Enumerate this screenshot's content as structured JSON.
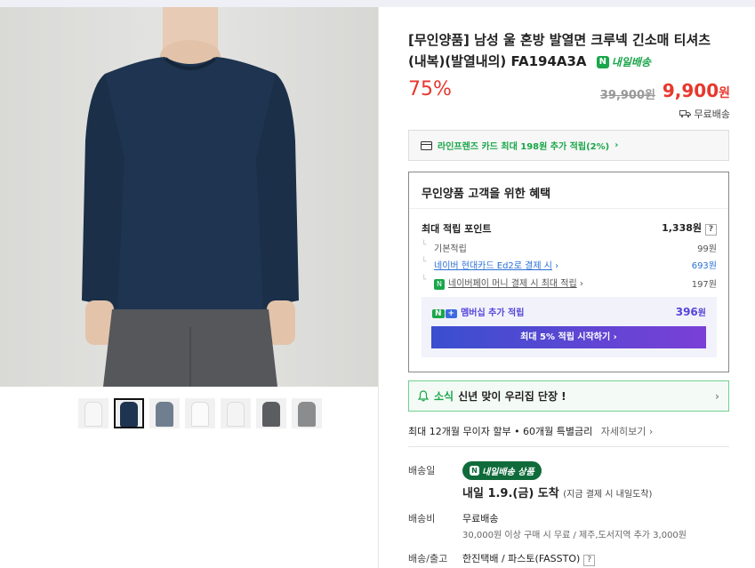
{
  "product": {
    "title": "[무인양품] 남성 울 혼방 발열면 크루넥 긴소매 티셔츠 (내복)(발열내의) FA194A3A",
    "delivery_tag": "내일배송",
    "discount": "75%",
    "original_price": "39,900원",
    "price": "9,900",
    "price_unit": "원",
    "shipping": "무료배송"
  },
  "card_promo": "라인프렌즈 카드 최대 198원 추가 적립(2%)",
  "benefits": {
    "heading": "무인양품 고객을 위한 혜택",
    "max_points_label": "최대 적립 포인트",
    "max_points_value": "1,338원",
    "rows": [
      {
        "label": "기본적립",
        "value": "99원"
      },
      {
        "label": "네이버 현대카드 Ed2로 결제 시",
        "value": "693원"
      },
      {
        "label": "네이버페이 머니 결제 시 최대 적립",
        "value": "197원"
      }
    ],
    "member_label": "멤버십 추가 적립",
    "member_value": "396",
    "member_unit": "원",
    "start_button": "최대 5% 적립 시작하기"
  },
  "news": {
    "tag": "소식",
    "text": "신년 맞이 우리집 단장 !"
  },
  "installment": {
    "text": "최대 12개월 무이자 할부 • 60개월 특별금리",
    "more": "자세히보기"
  },
  "delivery": {
    "label": "배송일",
    "badge": "내일배송 상품",
    "date": "내일 1.9.(금) 도착",
    "date_note": "(지금 결제 시 내일도착)",
    "fee_label": "배송비",
    "fee_value": "무료배송",
    "fee_note": "30,000원 이상 구매 시 무료 / 제주,도서지역 추가 3,000원",
    "carrier_label": "배송/출고",
    "carrier_value": "한진택배 / 파스토(FASSTO)"
  },
  "colors": {
    "sale_red": "#e8372d",
    "naver_green": "#1aa64a",
    "shirt_navy": "#1e3450"
  },
  "thumbnails": [
    "white-shirt",
    "navy-shirt",
    "gray-blue-shirt",
    "white-shirt",
    "white-shirt",
    "charcoal-shirt",
    "gray-shirt"
  ]
}
